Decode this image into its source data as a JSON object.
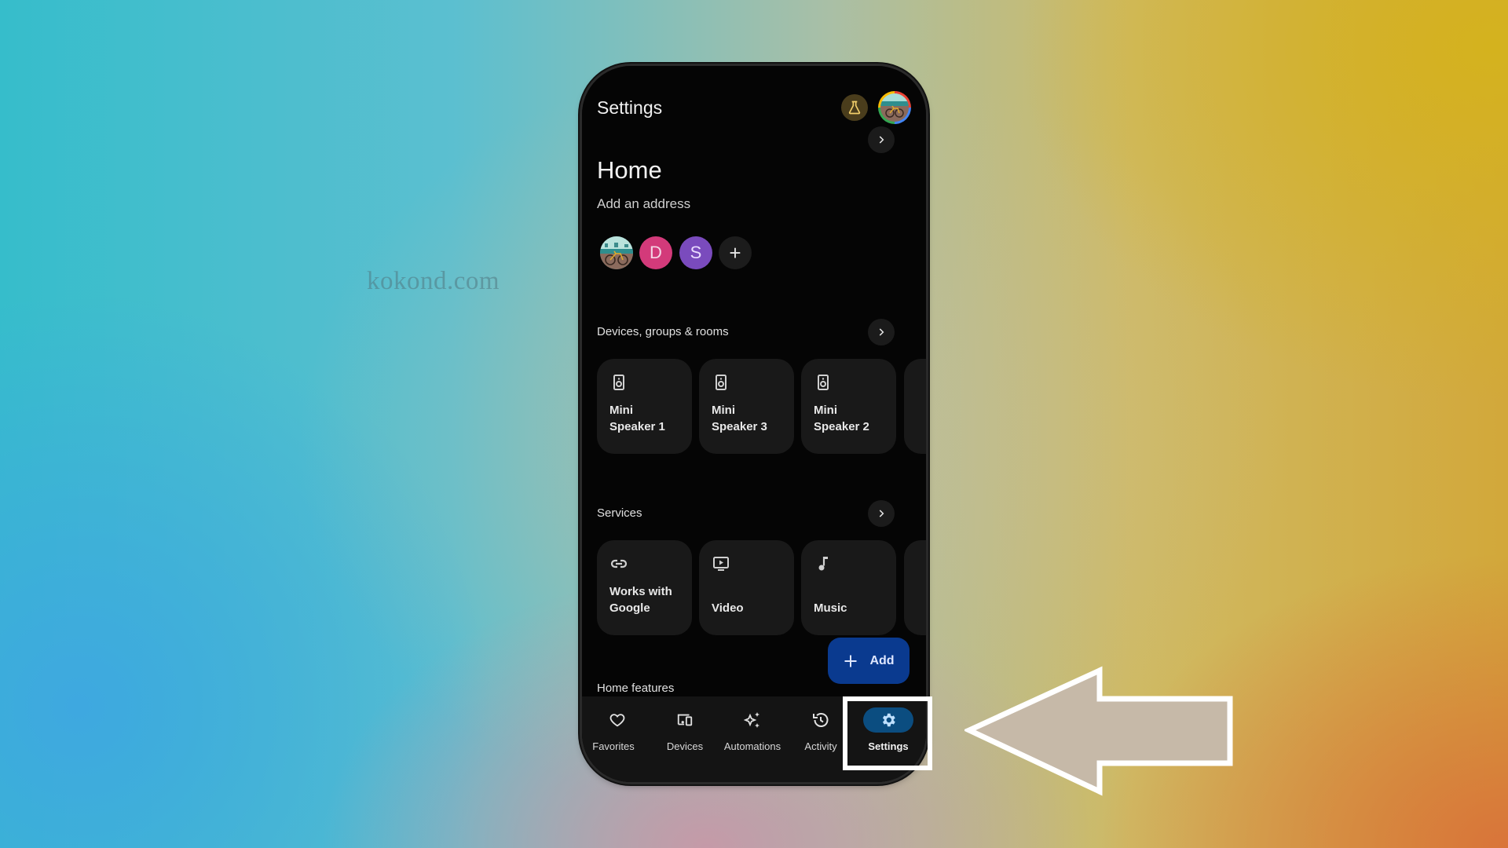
{
  "watermark": "kokond.com",
  "app": {
    "title": "Settings",
    "labs_icon": "flask-icon",
    "account_icon": "account-avatar"
  },
  "home": {
    "name": "Home",
    "subtitle": "Add an address",
    "members": [
      {
        "type": "photo",
        "label": "",
        "color": "#5aa7a0"
      },
      {
        "type": "initial",
        "label": "D",
        "color": "#d33a7a"
      },
      {
        "type": "initial",
        "label": "S",
        "color": "#7a4bbd"
      },
      {
        "type": "add",
        "label": "+",
        "color": "#1c1c1c"
      }
    ]
  },
  "devices_section": {
    "title": "Devices, groups & rooms",
    "cards": [
      {
        "line1": "Mini",
        "line2": "Speaker 1",
        "icon": "speaker-icon"
      },
      {
        "line1": "Mini",
        "line2": "Speaker 3",
        "icon": "speaker-icon"
      },
      {
        "line1": "Mini",
        "line2": "Speaker 2",
        "icon": "speaker-icon"
      }
    ]
  },
  "services_section": {
    "title": "Services",
    "cards": [
      {
        "line1": "Works with",
        "line2": "Google",
        "icon": "link-icon"
      },
      {
        "line1": "",
        "line2": "Video",
        "icon": "video-icon"
      },
      {
        "line1": "",
        "line2": "Music",
        "icon": "music-note-icon"
      }
    ]
  },
  "fab": {
    "label": "Add",
    "color": "#0a3a8f"
  },
  "home_features": {
    "title": "Home features"
  },
  "nav": {
    "items": [
      {
        "label": "Favorites",
        "icon": "heart-icon",
        "active": false
      },
      {
        "label": "Devices",
        "icon": "devices-icon",
        "active": false
      },
      {
        "label": "Automations",
        "icon": "sparkle-icon",
        "active": false
      },
      {
        "label": "Activity",
        "icon": "history-icon",
        "active": false
      },
      {
        "label": "Settings",
        "icon": "gear-icon",
        "active": true
      }
    ],
    "active_color": "#0b4d80"
  },
  "annotation": {
    "arrow_direction": "left",
    "arrow_fill": "#c6b9a8",
    "highlight": "Settings"
  }
}
